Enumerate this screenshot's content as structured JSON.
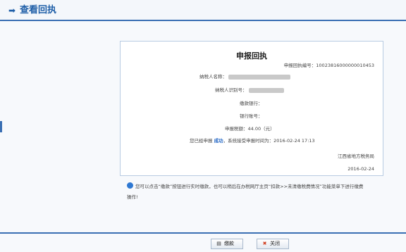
{
  "header": {
    "arrow_icon": "right-arrow-icon",
    "title": "查看回执"
  },
  "receipt": {
    "title": "申报回执",
    "receipt_no_label": "申报回执编号：",
    "receipt_no": "10023816000000010453",
    "taxpayer_name_label": "纳税人名称：",
    "taxpayer_id_label": "纳税人识别号：",
    "bank_label": "缴款银行：",
    "account_label": "银行账号：",
    "amount_label": "申报税额：",
    "amount": "44.00（元）",
    "status_prefix": "您已经申报",
    "status_value": "成功",
    "status_suffix": "，系统接受申报时间为：",
    "status_time": "2016-02-24 17:13",
    "authority": "江西省地方税务局",
    "date": "2016-02-24"
  },
  "note": {
    "icon": "info-icon",
    "text": "您可以点击“缴款”按钮进行实时缴款，也可以稍后在办税网厅主页“扣款>>未清缴税费情况”功能菜单下进行缴费操作!"
  },
  "buttons": {
    "pay_label": "缴款",
    "pay_icon": "save-icon",
    "close_label": "关闭",
    "close_icon": "close-icon"
  },
  "colors": {
    "accent": "#3a6fb3",
    "title_blue": "#1f5fa8",
    "success": "#1e63c4"
  }
}
